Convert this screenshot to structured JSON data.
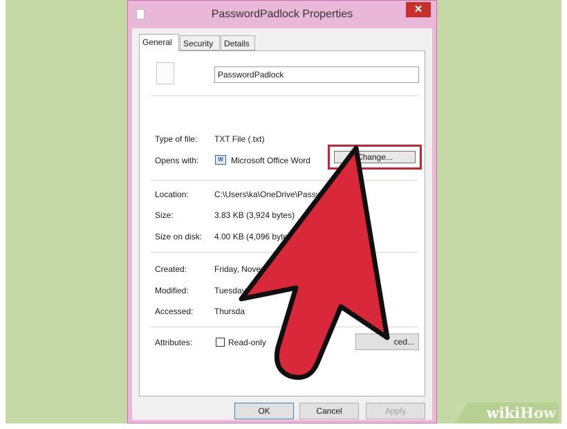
{
  "window": {
    "title": "PasswordPadlock Properties",
    "close_glyph": "✕"
  },
  "tabs": [
    {
      "label": "General",
      "active": true
    },
    {
      "label": "Security",
      "active": false
    },
    {
      "label": "Details",
      "active": false
    }
  ],
  "general": {
    "filename": "PasswordPadlock",
    "type_label": "Type of file:",
    "type_value": "TXT File (.txt)",
    "opens_label": "Opens with:",
    "opens_value": "Microsoft Office Word",
    "change_label": "Change...",
    "location_label": "Location:",
    "location_value": "C:\\Users\\ka\\OneDrive\\PasswordPadlock",
    "size_label": "Size:",
    "size_value": "3.83 KB (3,924 bytes)",
    "size_disk_label": "Size on disk:",
    "size_disk_value": "4.00 KB (4,096 bytes)",
    "created_label": "Created:",
    "created_value": "Friday, November",
    "modified_label": "Modified:",
    "modified_value": "Tuesday, Ju",
    "accessed_label": "Accessed:",
    "accessed_value": "Thursda",
    "attributes_label": "Attributes:",
    "readonly_label": "Read-only",
    "advanced_label": "ced..."
  },
  "footer": {
    "ok": "OK",
    "cancel": "Cancel",
    "apply": "Apply"
  },
  "watermark": {
    "part1": "wiki",
    "part2": "How"
  },
  "colors": {
    "window_frame": "#e9b8d8",
    "highlight": "#c52430",
    "arrow_fill": "#d8283a",
    "background_panel": "#c5d9a6"
  },
  "icons": {
    "file_title": "file-icon",
    "document": "document-icon",
    "word": "word-app-icon",
    "close": "close-icon",
    "arrow": "red-pointer-arrow"
  }
}
